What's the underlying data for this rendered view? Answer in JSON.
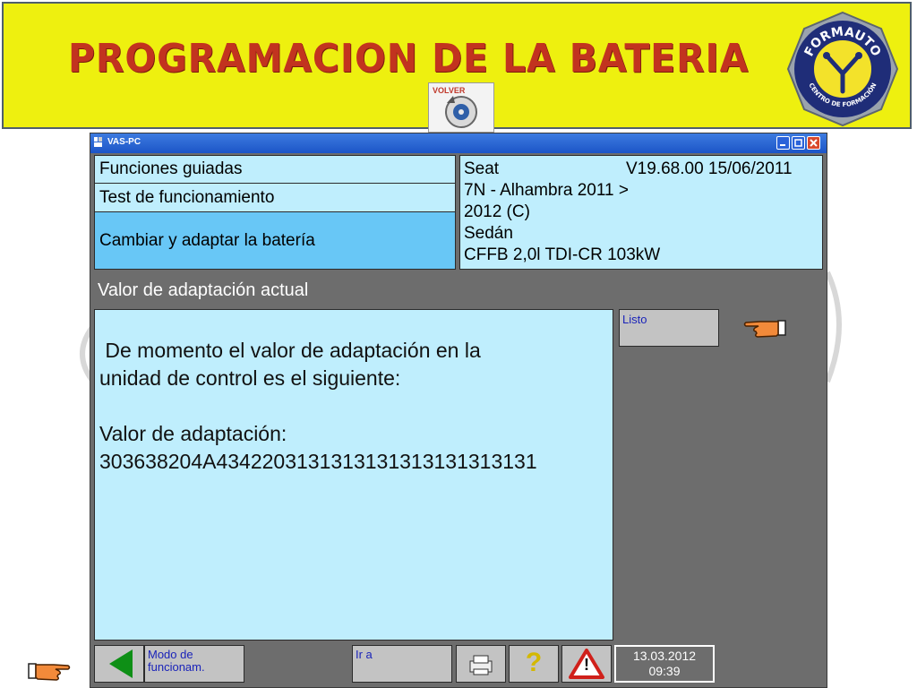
{
  "banner": {
    "title": "PROGRAMACION DE LA BATERIA",
    "back_label": "VOLVER",
    "logo_top_text": "FORMAUTO",
    "logo_bottom_text": "CENTRO DE FORMACIÓN"
  },
  "window": {
    "title": "VAS-PC",
    "nav": {
      "item1": "Funciones guiadas",
      "item2": "Test de funcionamiento",
      "item3": "Cambiar y adaptar la batería"
    },
    "vehicle": {
      "make": "Seat",
      "version": "V19.68.00 15/06/2011",
      "model_line1": "7N - Alhambra 2011 >",
      "model_line2": "2012 (C)",
      "body": "Sedán",
      "engine": "CFFB 2,0l TDI-CR 103kW"
    },
    "heading": "Valor de adaptación actual",
    "content": {
      "line1": " De momento el valor de adaptación en la",
      "line2": "unidad de control es el siguiente:",
      "label": "Valor de adaptación:",
      "value": "303638204A4342203131313131313131313131"
    },
    "listo_label": "Listo",
    "toolbar": {
      "mode_label_line1": "Modo de",
      "mode_label_line2": "funcionam.",
      "goto_label": "Ir a",
      "help_glyph": "?",
      "warning_glyph": "!",
      "date": "13.03.2012",
      "time": "09:39"
    }
  },
  "colors": {
    "banner_bg": "#eef00f",
    "title_red": "#c2331f",
    "panel_light_blue": "#bfeefd",
    "panel_active_blue": "#68c7f6",
    "window_gray": "#6d6d6d",
    "button_gray": "#c3c3c3",
    "button_text_blue": "#1a23b9",
    "back_arrow_green": "#0e8f16"
  }
}
